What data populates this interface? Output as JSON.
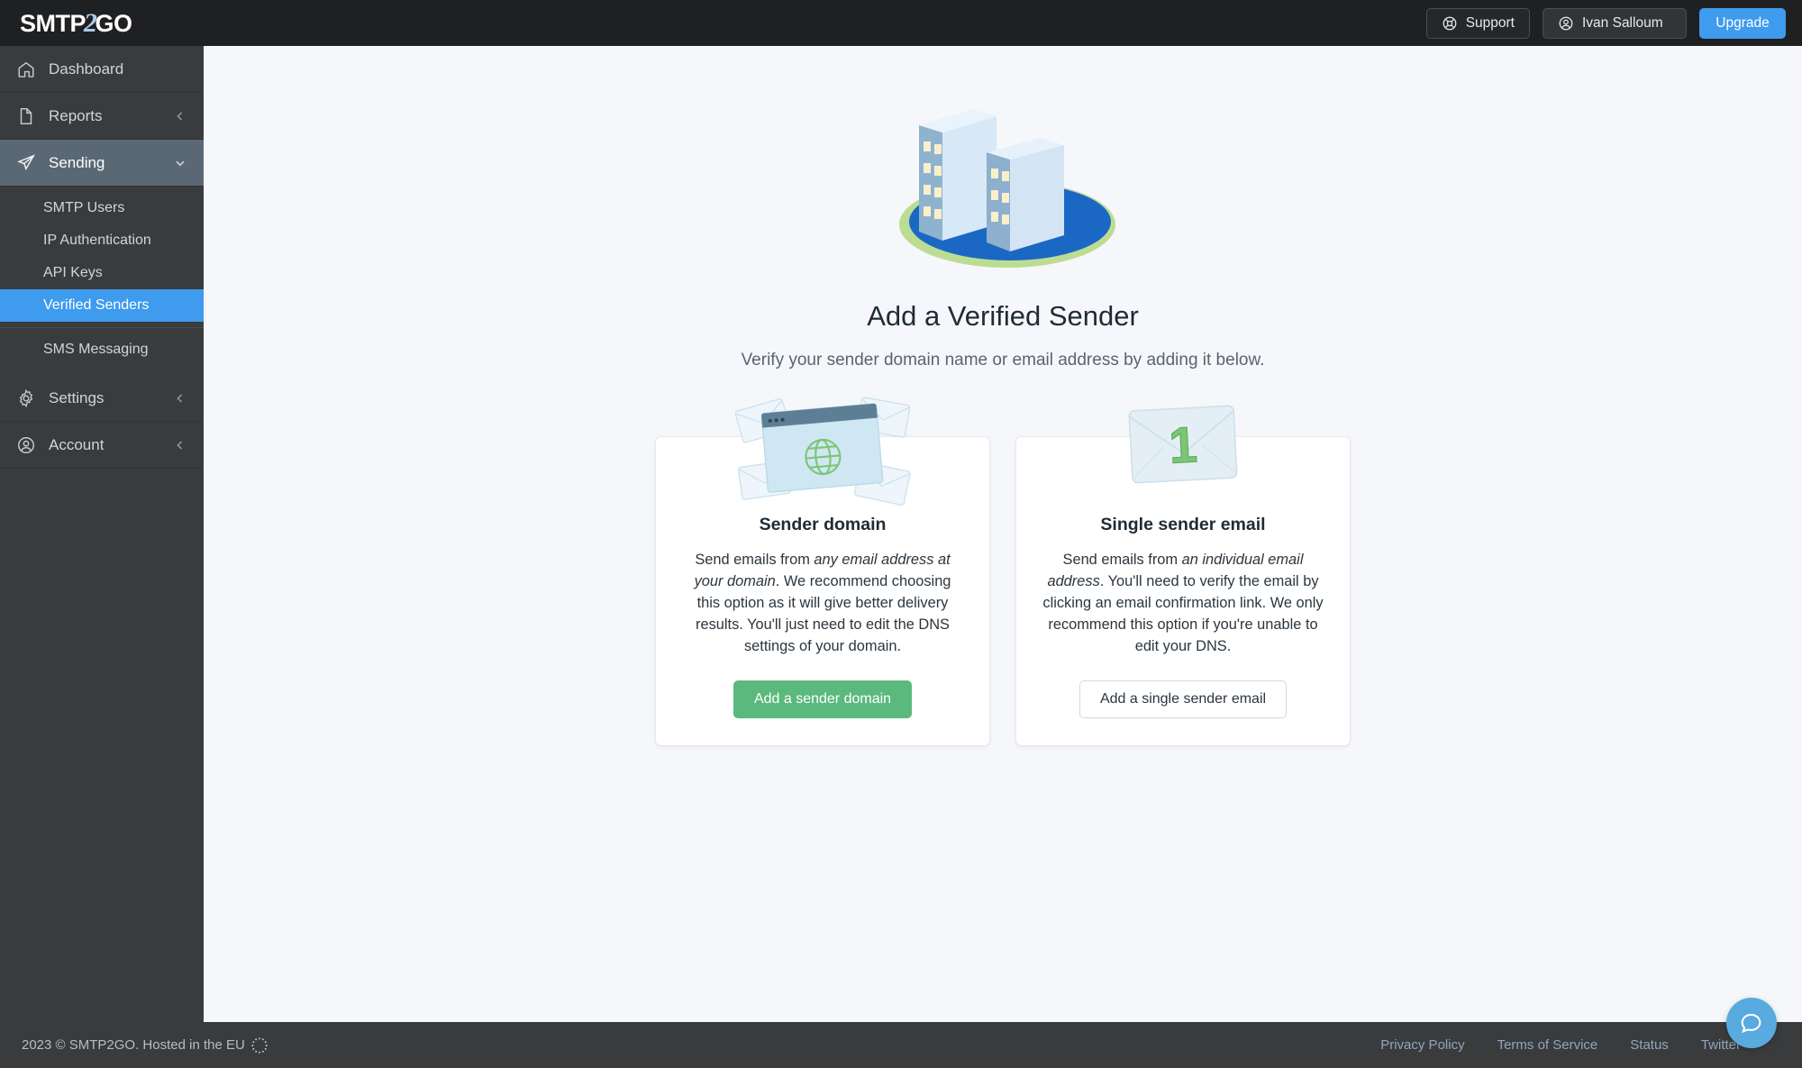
{
  "topbar": {
    "logo_main": "SMTP",
    "logo_two": "2",
    "logo_tail": "GO",
    "support_label": "Support",
    "support_icon": "lifebuoy-icon",
    "account_label": "Ivan Salloum",
    "account_icon": "user-circle-icon",
    "upgrade_label": "Upgrade",
    "accent_blue": "#3e9bed"
  },
  "sidebar": {
    "items": [
      {
        "label": "Dashboard",
        "icon": "home-icon",
        "chevron": "none",
        "state": "default"
      },
      {
        "label": "Reports",
        "icon": "document-icon",
        "chevron": "left",
        "state": "default"
      },
      {
        "label": "Sending",
        "icon": "paper-plane-icon",
        "chevron": "down",
        "state": "active-parent"
      },
      {
        "label": "Settings",
        "icon": "gear-icon",
        "chevron": "left",
        "state": "default"
      },
      {
        "label": "Account",
        "icon": "user-circle-icon",
        "chevron": "left",
        "state": "default"
      }
    ],
    "subitems_group1": [
      {
        "label": "SMTP Users",
        "state": "default"
      },
      {
        "label": "IP Authentication",
        "state": "default"
      },
      {
        "label": "API Keys",
        "state": "default"
      },
      {
        "label": "Verified Senders",
        "state": "selected"
      }
    ],
    "subitems_group2": [
      {
        "label": "SMS Messaging",
        "state": "default"
      }
    ],
    "selected_color": "#3e9bed",
    "active_parent_color": "#5a6876"
  },
  "main": {
    "hero_icon": "office-buildings-illustration",
    "title": "Add a Verified Sender",
    "subtitle": "Verify your sender domain name or email address by adding it below.",
    "cards": [
      {
        "art": "browser-globe-envelopes-illustration",
        "title": "Sender domain",
        "text_parts": [
          {
            "text": "Send emails from ",
            "italic": false
          },
          {
            "text": "any email address at your domain",
            "italic": true
          },
          {
            "text": ". We recommend choosing this option as it will give better delivery results. You'll just need to edit the DNS settings of your domain.",
            "italic": false
          }
        ],
        "button_label": "Add a sender domain",
        "button_style": "primary",
        "button_color": "#5bb97e"
      },
      {
        "art": "envelope-one-illustration",
        "title": "Single sender email",
        "text_parts": [
          {
            "text": "Send emails from ",
            "italic": false
          },
          {
            "text": "an individual email address",
            "italic": true
          },
          {
            "text": ". You'll need to verify the email by clicking an email confirmation link. We only recommend this option if you're unable to edit your DNS.",
            "italic": false
          }
        ],
        "button_label": "Add a single sender email",
        "button_style": "ghost",
        "button_color": "#ffffff"
      }
    ]
  },
  "footer": {
    "copyright": "2023 © SMTP2GO.  Hosted in the EU",
    "eu_icon": "eu-stars-icon",
    "links": [
      {
        "label": "Privacy Policy"
      },
      {
        "label": "Terms of Service"
      },
      {
        "label": "Status"
      },
      {
        "label": "Twitter"
      }
    ],
    "link_color": "#8fa6bd"
  },
  "chat": {
    "icon": "chat-bubble-icon",
    "color": "#58aadf"
  }
}
